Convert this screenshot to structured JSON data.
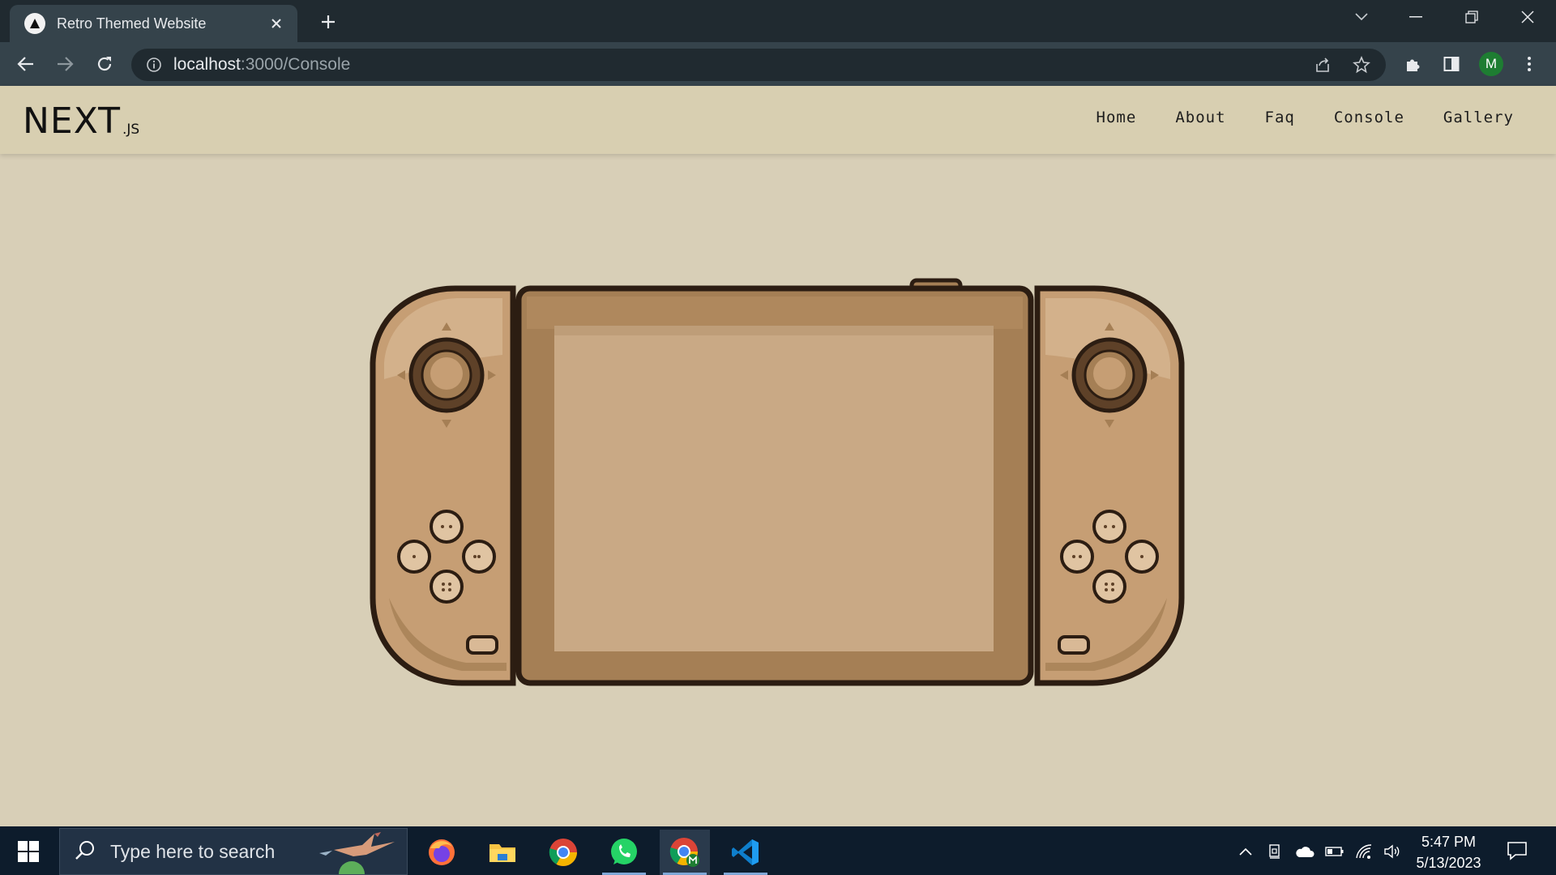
{
  "browser": {
    "tab_title": "Retro Themed Website",
    "url_host": "localhost",
    "url_path": ":3000/Console",
    "profile_initial": "M"
  },
  "site": {
    "logo_main": "NEXT",
    "logo_sub": ".JS",
    "nav": [
      "Home",
      "About",
      "Faq",
      "Console",
      "Gallery"
    ],
    "colors": {
      "background": "#d8cfb7",
      "console_body": "#a57f55",
      "screen": "#c9a985",
      "joycon": "#c9a27a",
      "outline": "#2c1d12"
    }
  },
  "taskbar": {
    "search_placeholder": "Type here to search",
    "time": "5:47 PM",
    "date": "5/13/2023",
    "apps": [
      "firefox-icon",
      "file-explorer-icon",
      "chrome-icon",
      "whatsapp-icon",
      "chrome-profile-icon",
      "vscode-icon"
    ]
  }
}
